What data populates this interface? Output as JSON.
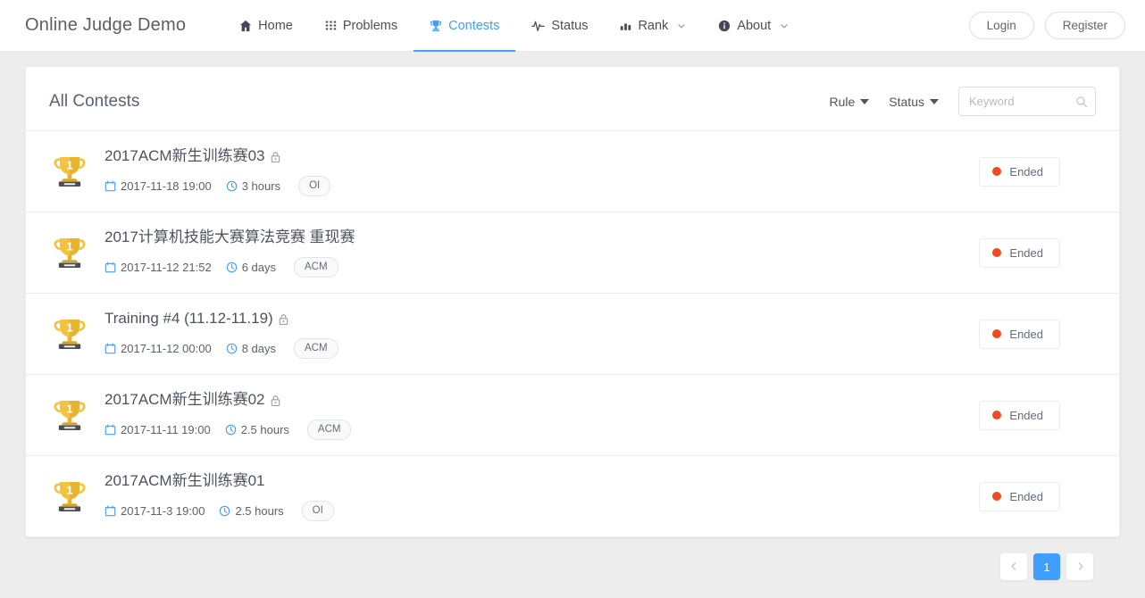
{
  "navbar": {
    "brand": "Online Judge Demo",
    "items": [
      {
        "label": "Home",
        "icon": "home-icon",
        "active": false,
        "caret": false
      },
      {
        "label": "Problems",
        "icon": "grid-icon",
        "active": false,
        "caret": false
      },
      {
        "label": "Contests",
        "icon": "trophy-icon",
        "active": true,
        "caret": false
      },
      {
        "label": "Status",
        "icon": "pulse-icon",
        "active": false,
        "caret": false
      },
      {
        "label": "Rank",
        "icon": "bar-chart-icon",
        "active": false,
        "caret": true
      },
      {
        "label": "About",
        "icon": "info-icon",
        "active": false,
        "caret": true
      }
    ],
    "login_label": "Login",
    "register_label": "Register"
  },
  "main": {
    "title": "All Contests",
    "filters": {
      "rule_label": "Rule",
      "status_label": "Status"
    },
    "search": {
      "placeholder": "Keyword",
      "value": "",
      "icon": "search-icon"
    },
    "contests": [
      {
        "icon": "trophy-icon",
        "title": "2017ACM新生训练赛03",
        "private": true,
        "date": "2017-11-18 19:00",
        "duration": "3 hours",
        "rule": "OI",
        "status": "Ended",
        "status_color": "#f04a22"
      },
      {
        "icon": "trophy-icon",
        "title": "2017计算机技能大赛算法竞赛 重现赛",
        "private": false,
        "date": "2017-11-12 21:52",
        "duration": "6 days",
        "rule": "ACM",
        "status": "Ended",
        "status_color": "#f04a22"
      },
      {
        "icon": "trophy-icon",
        "title": "Training #4 (11.12-11.19)",
        "private": true,
        "date": "2017-11-12 00:00",
        "duration": "8 days",
        "rule": "ACM",
        "status": "Ended",
        "status_color": "#f04a22"
      },
      {
        "icon": "trophy-icon",
        "title": "2017ACM新生训练赛02",
        "private": true,
        "date": "2017-11-11 19:00",
        "duration": "2.5 hours",
        "rule": "ACM",
        "status": "Ended",
        "status_color": "#f04a22"
      },
      {
        "icon": "trophy-icon",
        "title": "2017ACM新生训练赛01",
        "private": false,
        "date": "2017-11-3 19:00",
        "duration": "2.5 hours",
        "rule": "OI",
        "status": "Ended",
        "status_color": "#f04a22"
      }
    ],
    "pagination": {
      "prev_icon": "chevron-left-icon",
      "next_icon": "chevron-right-icon",
      "pages": [
        "1"
      ],
      "current": "1"
    }
  },
  "colors": {
    "accent": "#409eff",
    "page_bg": "#ededed",
    "card_bg": "#ffffff",
    "trophy_gold": "#f5c33c",
    "status_red": "#f04a22"
  }
}
